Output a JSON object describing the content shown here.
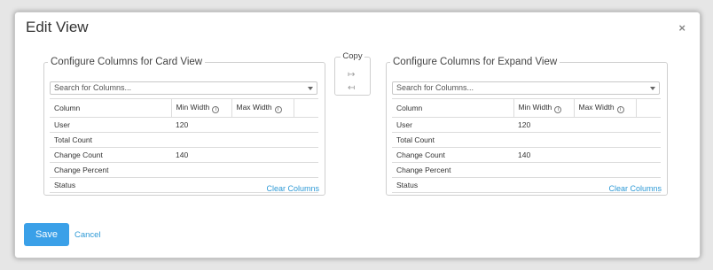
{
  "dialog": {
    "title": "Edit View",
    "close_label": "×",
    "save_label": "Save",
    "cancel_label": "Cancel"
  },
  "copy": {
    "label": "Copy",
    "to_right_icon": "↦",
    "to_left_icon": "↤"
  },
  "card_panel": {
    "legend": "Configure Columns for Card View",
    "search_placeholder": "Search for Columns...",
    "headers": [
      "Column",
      "Min Width",
      "Max Width"
    ],
    "rows": [
      {
        "column": "User",
        "min": "120",
        "max": ""
      },
      {
        "column": "Total Count",
        "min": "",
        "max": ""
      },
      {
        "column": "Change Count",
        "min": "140",
        "max": ""
      },
      {
        "column": "Change Percent",
        "min": "",
        "max": ""
      },
      {
        "column": "Status",
        "min": "",
        "max": ""
      }
    ],
    "clear_label": "Clear Columns"
  },
  "expand_panel": {
    "legend": "Configure Columns for Expand View",
    "search_placeholder": "Search for Columns...",
    "headers": [
      "Column",
      "Min Width",
      "Max Width"
    ],
    "rows": [
      {
        "column": "User",
        "min": "120",
        "max": ""
      },
      {
        "column": "Total Count",
        "min": "",
        "max": ""
      },
      {
        "column": "Change Count",
        "min": "140",
        "max": ""
      },
      {
        "column": "Change Percent",
        "min": "",
        "max": ""
      },
      {
        "column": "Status",
        "min": "",
        "max": ""
      }
    ],
    "clear_label": "Clear Columns"
  },
  "icons": {
    "info": "i",
    "dropdown": "chevron-down-icon",
    "copy_right": "arrow-right-icon",
    "copy_left": "arrow-left-icon"
  },
  "colors": {
    "accent": "#3aa0e8",
    "link": "#2f9ad6",
    "border": "#cfcfcf"
  }
}
